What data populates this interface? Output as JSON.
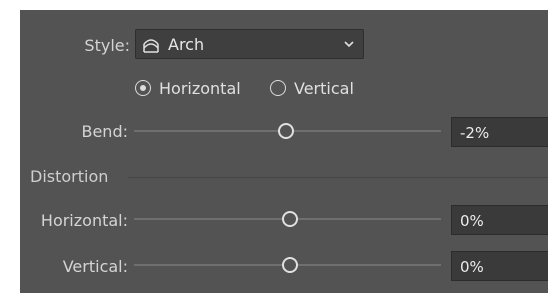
{
  "style_row": {
    "label": "Style:",
    "selected": "Arch",
    "icon": "arch-warp-icon",
    "chevron": "chevron-down-icon"
  },
  "orientation": {
    "options": [
      {
        "label": "Horizontal",
        "selected": true
      },
      {
        "label": "Vertical",
        "selected": false
      }
    ]
  },
  "bend": {
    "label": "Bend:",
    "value": "-2%",
    "slider_level": -0.02
  },
  "distortion": {
    "title": "Distortion",
    "horizontal": {
      "label": "Horizontal:",
      "value": "0%",
      "slider_level": 0.0
    },
    "vertical": {
      "label": "Vertical:",
      "value": "0%",
      "slider_level": 0.0
    }
  },
  "colors": {
    "panel": "#535353",
    "field": "#3a3a3a",
    "text": "#d9d9d9",
    "track": "#6f6f6f"
  }
}
